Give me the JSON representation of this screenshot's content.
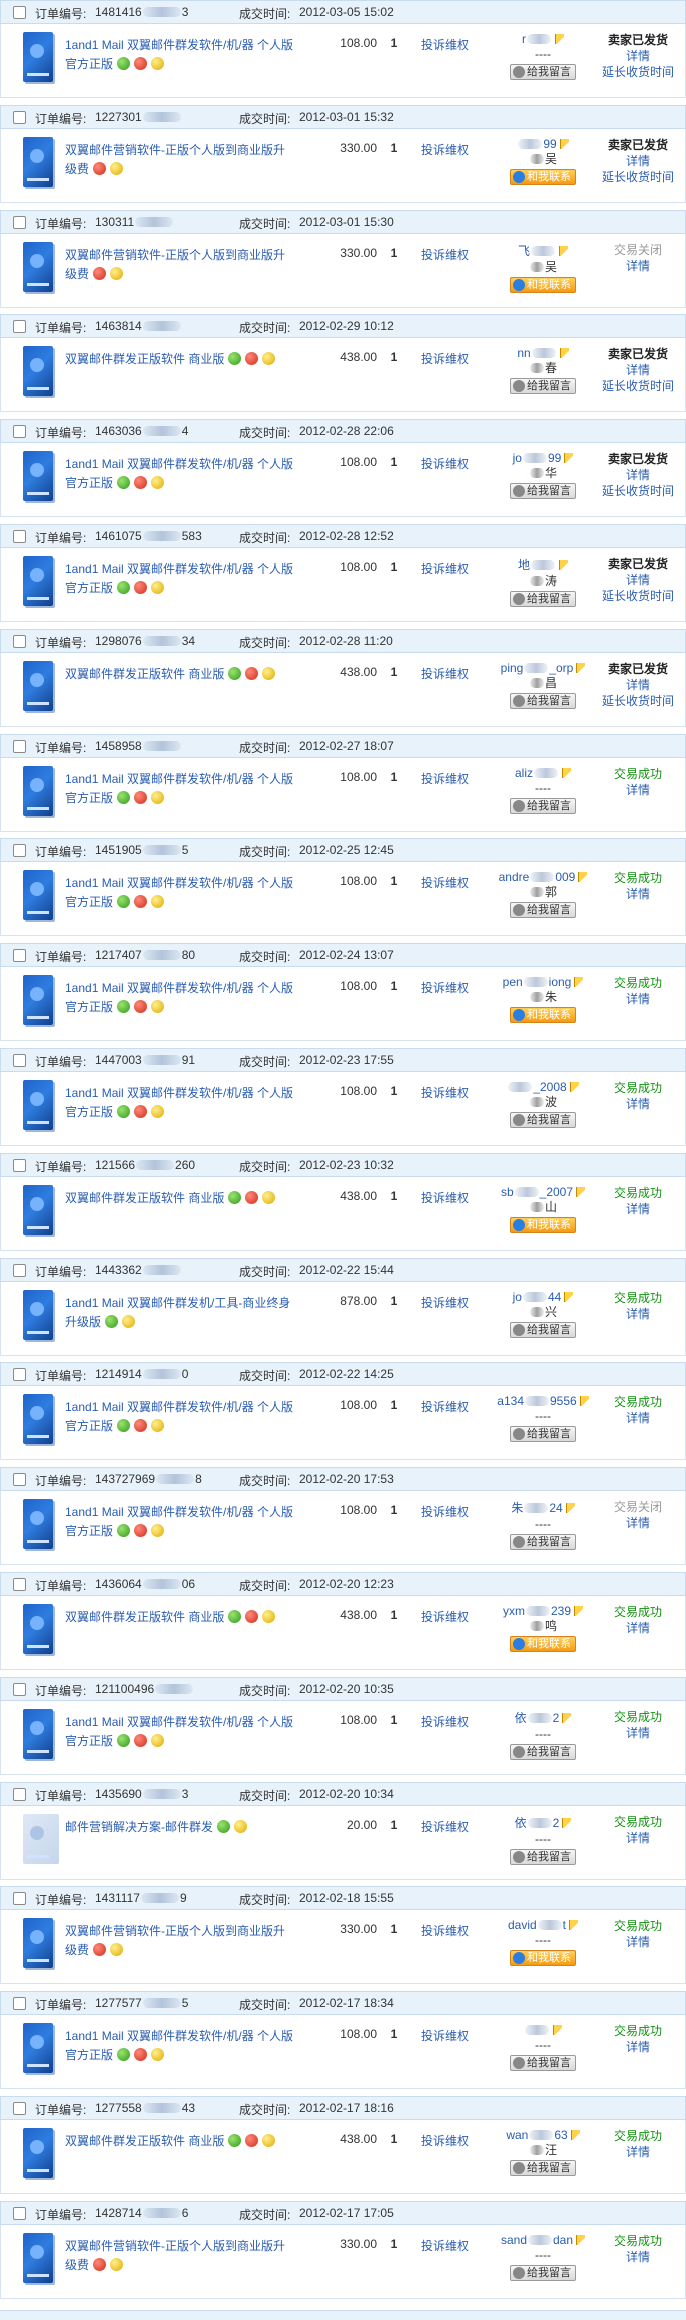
{
  "labels": {
    "order_no": "订单编号:",
    "deal_time": "成交时间:",
    "complain": "投诉维权",
    "contact": "给我留言",
    "contact_online": "和我联系",
    "detail": "详情",
    "extend": "延长收货时间",
    "empty_real": "----"
  },
  "orders": [
    {
      "order_prefix": "1481416",
      "order_suffix": "3",
      "time": "2012-03-05 15:02",
      "title": "1and1 Mail 双翼邮件群发软件/机/器 个人版 官方正版",
      "badges": [
        "green",
        "red",
        "yellow"
      ],
      "price": "108.00",
      "qty": "1",
      "buyer_prefix": "r",
      "buyer_suffix": "",
      "real": "----",
      "online": false,
      "status": "卖家已发货",
      "status_type": "shipped",
      "extend": true,
      "thumb": "box"
    },
    {
      "order_prefix": "1227301",
      "order_suffix": "",
      "time": "2012-03-01 15:32",
      "title": "双翼邮件营销软件-正版个人版到商业版升级费",
      "badges": [
        "red",
        "yellow"
      ],
      "price": "330.00",
      "qty": "1",
      "buyer_prefix": "",
      "buyer_suffix": "99",
      "real": "吴",
      "online": true,
      "status": "卖家已发货",
      "status_type": "shipped",
      "extend": true,
      "thumb": "box"
    },
    {
      "order_prefix": "130311",
      "order_suffix": "",
      "time": "2012-03-01 15:30",
      "title": "双翼邮件营销软件-正版个人版到商业版升级费",
      "badges": [
        "red",
        "yellow"
      ],
      "price": "330.00",
      "qty": "1",
      "buyer_prefix": "飞",
      "buyer_suffix": "",
      "real": "吴",
      "online": true,
      "status": "交易关闭",
      "status_type": "closed",
      "extend": false,
      "thumb": "box"
    },
    {
      "order_prefix": "1463814",
      "order_suffix": "",
      "time": "2012-02-29 10:12",
      "title": "双翼邮件群发正版软件 商业版",
      "badges": [
        "green",
        "red",
        "yellow"
      ],
      "price": "438.00",
      "qty": "1",
      "buyer_prefix": "nn",
      "buyer_suffix": "",
      "real": "春",
      "online": false,
      "status": "卖家已发货",
      "status_type": "shipped",
      "extend": true,
      "thumb": "box"
    },
    {
      "order_prefix": "1463036",
      "order_suffix": "4",
      "time": "2012-02-28 22:06",
      "title": "1and1 Mail 双翼邮件群发软件/机/器 个人版 官方正版",
      "badges": [
        "green",
        "red",
        "yellow"
      ],
      "price": "108.00",
      "qty": "1",
      "buyer_prefix": "jo",
      "buyer_suffix": "99",
      "real": "华",
      "online": false,
      "status": "卖家已发货",
      "status_type": "shipped",
      "extend": true,
      "thumb": "box"
    },
    {
      "order_prefix": "1461075",
      "order_suffix": "583",
      "time": "2012-02-28 12:52",
      "title": "1and1 Mail 双翼邮件群发软件/机/器 个人版 官方正版",
      "badges": [
        "green",
        "red",
        "yellow"
      ],
      "price": "108.00",
      "qty": "1",
      "buyer_prefix": "地",
      "buyer_suffix": "",
      "real": "涛",
      "online": false,
      "status": "卖家已发货",
      "status_type": "shipped",
      "extend": true,
      "thumb": "box"
    },
    {
      "order_prefix": "1298076",
      "order_suffix": "34",
      "time": "2012-02-28 11:20",
      "title": "双翼邮件群发正版软件 商业版",
      "badges": [
        "green",
        "red",
        "yellow"
      ],
      "price": "438.00",
      "qty": "1",
      "buyer_prefix": "ping",
      "buyer_suffix": "_orp",
      "real": "昌",
      "online": false,
      "status": "卖家已发货",
      "status_type": "shipped",
      "extend": true,
      "thumb": "box"
    },
    {
      "order_prefix": "1458958",
      "order_suffix": "",
      "time": "2012-02-27 18:07",
      "title": "1and1 Mail 双翼邮件群发软件/机/器 个人版 官方正版",
      "badges": [
        "green",
        "red",
        "yellow"
      ],
      "price": "108.00",
      "qty": "1",
      "buyer_prefix": "aliz",
      "buyer_suffix": "",
      "real": "----",
      "online": false,
      "status": "交易成功",
      "status_type": "success",
      "extend": false,
      "thumb": "box"
    },
    {
      "order_prefix": "1451905",
      "order_suffix": "5",
      "time": "2012-02-25 12:45",
      "title": "1and1 Mail 双翼邮件群发软件/机/器 个人版 官方正版",
      "badges": [
        "green",
        "red",
        "yellow"
      ],
      "price": "108.00",
      "qty": "1",
      "buyer_prefix": "andre",
      "buyer_suffix": "009",
      "real": "郭",
      "online": false,
      "status": "交易成功",
      "status_type": "success",
      "extend": false,
      "thumb": "box"
    },
    {
      "order_prefix": "1217407",
      "order_suffix": "80",
      "time": "2012-02-24 13:07",
      "title": "1and1 Mail 双翼邮件群发软件/机/器 个人版 官方正版",
      "badges": [
        "green",
        "red",
        "yellow"
      ],
      "price": "108.00",
      "qty": "1",
      "buyer_prefix": "pen",
      "buyer_suffix": "iong",
      "real": "朱",
      "online": true,
      "status": "交易成功",
      "status_type": "success",
      "extend": false,
      "thumb": "box"
    },
    {
      "order_prefix": "1447003",
      "order_suffix": "91",
      "time": "2012-02-23 17:55",
      "title": "1and1 Mail 双翼邮件群发软件/机/器 个人版 官方正版",
      "badges": [
        "green",
        "red",
        "yellow"
      ],
      "price": "108.00",
      "qty": "1",
      "buyer_prefix": "",
      "buyer_suffix": "_2008",
      "real": "波",
      "online": false,
      "status": "交易成功",
      "status_type": "success",
      "extend": false,
      "thumb": "box"
    },
    {
      "order_prefix": "121566",
      "order_suffix": "260",
      "time": "2012-02-23 10:32",
      "title": "双翼邮件群发正版软件 商业版",
      "badges": [
        "green",
        "red",
        "yellow"
      ],
      "price": "438.00",
      "qty": "1",
      "buyer_prefix": "sb",
      "buyer_suffix": "_2007",
      "real": "山",
      "online": true,
      "status": "交易成功",
      "status_type": "success",
      "extend": false,
      "thumb": "box"
    },
    {
      "order_prefix": "1443362",
      "order_suffix": "",
      "time": "2012-02-22 15:44",
      "title": "1and1 Mail 双翼邮件群发机/工具-商业终身升级版",
      "badges": [
        "green",
        "yellow"
      ],
      "price": "878.00",
      "qty": "1",
      "buyer_prefix": "jo",
      "buyer_suffix": "44",
      "real": "兴",
      "online": false,
      "status": "交易成功",
      "status_type": "success",
      "extend": false,
      "thumb": "box"
    },
    {
      "order_prefix": "1214914",
      "order_suffix": "0",
      "time": "2012-02-22 14:25",
      "title": "1and1 Mail 双翼邮件群发软件/机/器 个人版 官方正版",
      "badges": [
        "green",
        "red",
        "yellow"
      ],
      "price": "108.00",
      "qty": "1",
      "buyer_prefix": "a134",
      "buyer_suffix": "9556",
      "real": "----",
      "online": false,
      "status": "交易成功",
      "status_type": "success",
      "extend": false,
      "thumb": "box"
    },
    {
      "order_prefix": "143727969",
      "order_suffix": "8",
      "time": "2012-02-20 17:53",
      "title": "1and1 Mail 双翼邮件群发软件/机/器 个人版 官方正版",
      "badges": [
        "green",
        "red",
        "yellow"
      ],
      "price": "108.00",
      "qty": "1",
      "buyer_prefix": "朱",
      "buyer_suffix": "24",
      "real": "----",
      "online": false,
      "status": "交易关闭",
      "status_type": "closed",
      "extend": false,
      "thumb": "box"
    },
    {
      "order_prefix": "1436064",
      "order_suffix": "06",
      "time": "2012-02-20 12:23",
      "title": "双翼邮件群发正版软件 商业版",
      "badges": [
        "green",
        "red",
        "yellow"
      ],
      "price": "438.00",
      "qty": "1",
      "buyer_prefix": "yxm",
      "buyer_suffix": "239",
      "real": "鸣",
      "online": true,
      "status": "交易成功",
      "status_type": "success",
      "extend": false,
      "thumb": "box"
    },
    {
      "order_prefix": "121100496",
      "order_suffix": "",
      "time": "2012-02-20 10:35",
      "title": "1and1 Mail 双翼邮件群发软件/机/器 个人版 官方正版",
      "badges": [
        "green",
        "red",
        "yellow"
      ],
      "price": "108.00",
      "qty": "1",
      "buyer_prefix": "依",
      "buyer_suffix": "2",
      "real": "----",
      "online": false,
      "status": "交易成功",
      "status_type": "success",
      "extend": false,
      "thumb": "box"
    },
    {
      "order_prefix": "1435690",
      "order_suffix": "3",
      "time": "2012-02-20 10:34",
      "title": "邮件营销解决方案-邮件群发",
      "badges": [
        "green",
        "yellow"
      ],
      "price": "20.00",
      "qty": "1",
      "buyer_prefix": "依",
      "buyer_suffix": "2",
      "real": "----",
      "online": false,
      "status": "交易成功",
      "status_type": "success",
      "extend": false,
      "thumb": "alt"
    },
    {
      "order_prefix": "1431117",
      "order_suffix": "9",
      "time": "2012-02-18 15:55",
      "title": "双翼邮件营销软件-正版个人版到商业版升级费",
      "badges": [
        "red",
        "yellow"
      ],
      "price": "330.00",
      "qty": "1",
      "buyer_prefix": "david",
      "buyer_suffix": "t",
      "real": "----",
      "online": true,
      "status": "交易成功",
      "status_type": "success",
      "extend": false,
      "thumb": "box"
    },
    {
      "order_prefix": "1277577",
      "order_suffix": "5",
      "time": "2012-02-17 18:34",
      "title": "1and1 Mail 双翼邮件群发软件/机/器 个人版 官方正版",
      "badges": [
        "green",
        "red",
        "yellow"
      ],
      "price": "108.00",
      "qty": "1",
      "buyer_prefix": "",
      "buyer_suffix": "",
      "real": "----",
      "online": false,
      "status": "交易成功",
      "status_type": "success",
      "extend": false,
      "thumb": "box"
    },
    {
      "order_prefix": "1277558",
      "order_suffix": "43",
      "time": "2012-02-17 18:16",
      "title": "双翼邮件群发正版软件 商业版",
      "badges": [
        "green",
        "red",
        "yellow"
      ],
      "price": "438.00",
      "qty": "1",
      "buyer_prefix": "wan",
      "buyer_suffix": "63",
      "real": "汪",
      "online": false,
      "status": "交易成功",
      "status_type": "success",
      "extend": false,
      "thumb": "box"
    },
    {
      "order_prefix": "1428714",
      "order_suffix": "6",
      "time": "2012-02-17 17:05",
      "title": "双翼邮件营销软件-正版个人版到商业版升级费",
      "badges": [
        "red",
        "yellow"
      ],
      "price": "330.00",
      "qty": "1",
      "buyer_prefix": "sand",
      "buyer_suffix": "dan",
      "real": "----",
      "online": false,
      "status": "交易成功",
      "status_type": "success",
      "extend": false,
      "thumb": "box"
    }
  ]
}
